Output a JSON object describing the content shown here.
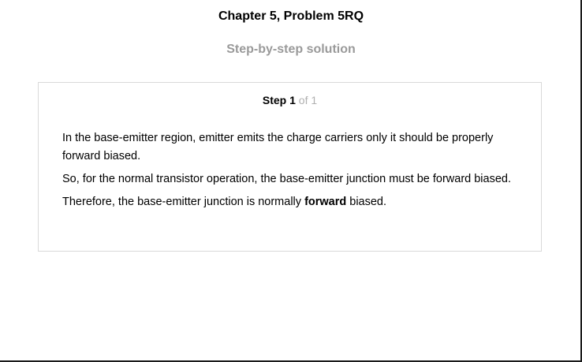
{
  "header": {
    "title": "Chapter 5, Problem 5RQ",
    "subtitle": "Step-by-step solution"
  },
  "step": {
    "word": "Step",
    "number": "1",
    "of_text": "of 1"
  },
  "solution": {
    "para1": "In the base-emitter region, emitter emits the charge carriers only it should be properly forward biased.",
    "para2": "So, for the normal transistor operation, the base-emitter junction must be forward biased.",
    "para3_before": "Therefore, the base-emitter junction is normally ",
    "para3_bold": "forward",
    "para3_after": " biased."
  }
}
